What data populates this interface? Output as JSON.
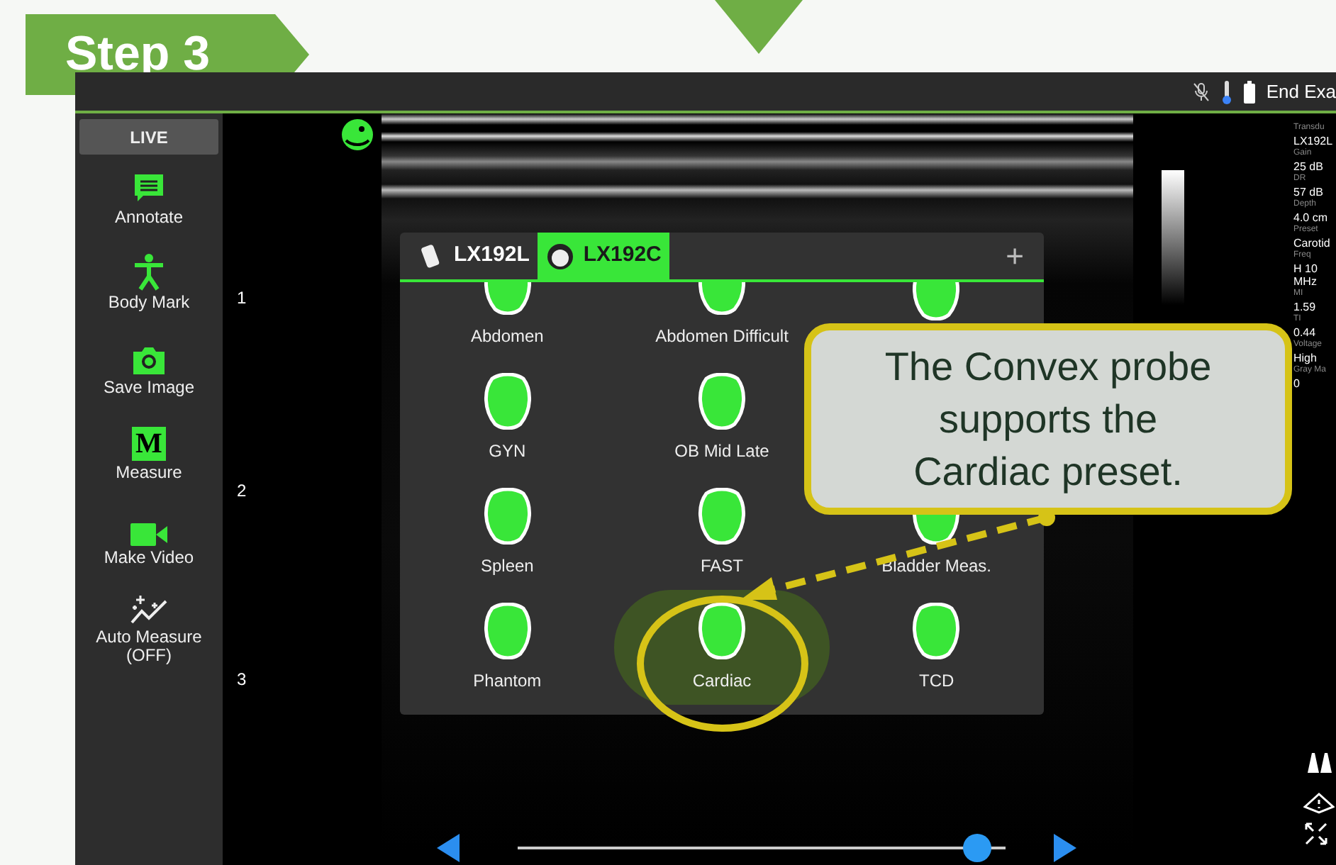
{
  "step_banner": {
    "label": "Step 3"
  },
  "top_bar": {
    "end_exam": "End Exa"
  },
  "sidebar": {
    "live_button": "LIVE",
    "items": [
      {
        "label": "Annotate"
      },
      {
        "label": "Body Mark"
      },
      {
        "label": "Save Image"
      },
      {
        "label": "Measure",
        "icon_text": "M"
      },
      {
        "label": "Make Video"
      },
      {
        "label": "Auto Measure (OFF)"
      }
    ]
  },
  "depth_markers": [
    "1",
    "2",
    "3"
  ],
  "probe_dialog": {
    "tabs": [
      {
        "label": "LX192L",
        "selected": false
      },
      {
        "label": "LX192C",
        "selected": true
      }
    ],
    "add_button": "+",
    "presets": [
      {
        "kind": "labeled",
        "label": "Abdomen"
      },
      {
        "kind": "labeled",
        "label": "Abdomen Difficult"
      },
      {
        "kind": "icon_only"
      },
      {
        "kind": "labeled",
        "label": "GYN"
      },
      {
        "kind": "labeled",
        "label": "OB Mid Late"
      },
      {
        "kind": "hidden"
      },
      {
        "kind": "labeled",
        "label": "Spleen"
      },
      {
        "kind": "labeled",
        "label": "FAST"
      },
      {
        "kind": "labeled",
        "label": "Bladder Meas."
      },
      {
        "kind": "labeled",
        "label": "Phantom"
      },
      {
        "kind": "labeled",
        "label": "Cardiac",
        "highlighted": true
      },
      {
        "kind": "labeled",
        "label": "TCD"
      }
    ]
  },
  "parameters": [
    {
      "name": "Transdu",
      "value": "LX192L"
    },
    {
      "name": "Gain",
      "value": "25 dB"
    },
    {
      "name": "DR",
      "value": "57 dB"
    },
    {
      "name": "Depth",
      "value": "4.0 cm"
    },
    {
      "name": "Preset",
      "value": "Carotid"
    },
    {
      "name": "Freq",
      "value": "H 10"
    },
    {
      "value": "MHz"
    },
    {
      "name": "MI",
      "value": "1.59"
    },
    {
      "name": "TI",
      "value": "0.44"
    },
    {
      "name": "Voltage",
      "value": "High"
    },
    {
      "name": "Gray Ma",
      "value": "0"
    }
  ],
  "frame_slider": {
    "level": 0.97
  },
  "callout": {
    "text": "The Convex probe supports the Cardiac preset."
  }
}
